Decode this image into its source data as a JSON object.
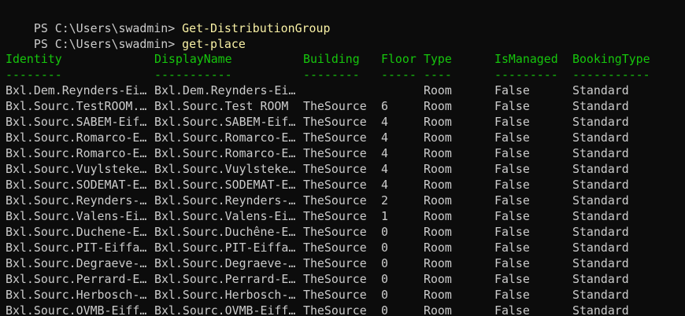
{
  "console": {
    "prompt": "PS C:\\Users\\swadmin> ",
    "commands": [
      "Get-DistributionGroup",
      "get-place"
    ]
  },
  "table": {
    "headers": [
      "Identity",
      "DisplayName",
      "Building",
      "Floor",
      "Type",
      "IsManaged",
      "BookingType"
    ],
    "underlines": [
      "--------",
      "-----------",
      "--------",
      "-----",
      "----",
      "---------",
      "-----------"
    ],
    "rows": [
      [
        "Bxl.Dem.Reynders-Ei…",
        "Bxl.Dem.Reynders-Ei…",
        "",
        "",
        "Room",
        "False",
        "Standard"
      ],
      [
        "Bxl.Sourc.TestROOM.…",
        "Bxl.Sourc.Test ROOM",
        "TheSource",
        "6",
        "Room",
        "False",
        "Standard"
      ],
      [
        "Bxl.Sourc.SABEM-Eif…",
        "Bxl.Sourc.SABEM-Eif…",
        "TheSource",
        "4",
        "Room",
        "False",
        "Standard"
      ],
      [
        "Bxl.Sourc.Romarco-E…",
        "Bxl.Sourc.Romarco-E…",
        "TheSource",
        "4",
        "Room",
        "False",
        "Standard"
      ],
      [
        "Bxl.Sourc.Romarco-E…",
        "Bxl.Sourc.Romarco-E…",
        "TheSource",
        "4",
        "Room",
        "False",
        "Standard"
      ],
      [
        "Bxl.Sourc.Vuylsteke…",
        "Bxl.Sourc.Vuylsteke…",
        "TheSource",
        "4",
        "Room",
        "False",
        "Standard"
      ],
      [
        "Bxl.Sourc.SODEMAT-E…",
        "Bxl.Sourc.SODEMAT-E…",
        "TheSource",
        "4",
        "Room",
        "False",
        "Standard"
      ],
      [
        "Bxl.Sourc.Reynders-…",
        "Bxl.Sourc.Reynders-…",
        "TheSource",
        "2",
        "Room",
        "False",
        "Standard"
      ],
      [
        "Bxl.Sourc.Valens-Ei…",
        "Bxl.Sourc.Valens-Ei…",
        "TheSource",
        "1",
        "Room",
        "False",
        "Standard"
      ],
      [
        "Bxl.Sourc.Duchene-E…",
        "Bxl.Sourc.Duchêne-E…",
        "TheSource",
        "0",
        "Room",
        "False",
        "Standard"
      ],
      [
        "Bxl.Sourc.PIT-Eiffa…",
        "Bxl.Sourc.PIT-Eiffa…",
        "TheSource",
        "0",
        "Room",
        "False",
        "Standard"
      ],
      [
        "Bxl.Sourc.Degraeve-…",
        "Bxl.Sourc.Degraeve-…",
        "TheSource",
        "0",
        "Room",
        "False",
        "Standard"
      ],
      [
        "Bxl.Sourc.Perrard-E…",
        "Bxl.Sourc.Perrard-E…",
        "TheSource",
        "0",
        "Room",
        "False",
        "Standard"
      ],
      [
        "Bxl.Sourc.Herbosch-…",
        "Bxl.Sourc.Herbosch-…",
        "TheSource",
        "0",
        "Room",
        "False",
        "Standard"
      ],
      [
        "Bxl.Sourc.OVMB-Eiff…",
        "Bxl.Sourc.OVMB-Eiff…",
        "TheSource",
        "0",
        "Room",
        "False",
        "Standard"
      ]
    ]
  },
  "colors": {
    "background": "#0c0c0c",
    "text": "#cccccc",
    "command": "#f9f1a5",
    "header": "#16c60c"
  }
}
